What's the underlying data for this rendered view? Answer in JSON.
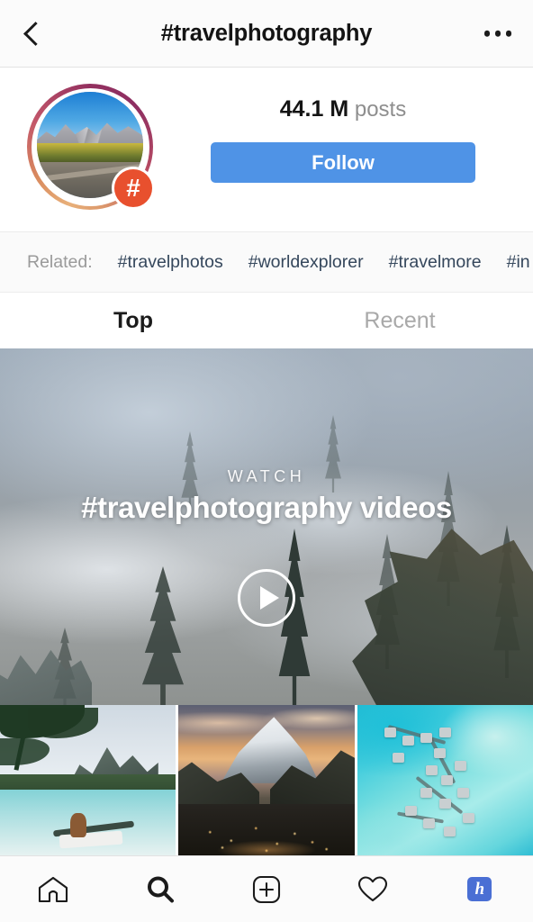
{
  "topbar": {
    "back_icon": "chevron-left-icon",
    "title": "#travelphotography",
    "menu_icon": "more-options-icon"
  },
  "profile": {
    "avatar_icon": "hashtag-avatar",
    "badge_glyph": "#",
    "post_count_value": "44.1 M",
    "post_count_label": "posts",
    "follow_label": "Follow",
    "follow_color": "#4f93e6"
  },
  "related": {
    "label": "Related:",
    "tags": [
      "#travelphotos",
      "#worldexplorer",
      "#travelmore",
      "#in"
    ]
  },
  "tabs": [
    {
      "label": "Top",
      "active": true
    },
    {
      "label": "Recent",
      "active": false
    }
  ],
  "hero": {
    "watch_label": "WATCH",
    "title": "#travelphotography videos",
    "play_icon": "play-circle-icon"
  },
  "grid": {
    "items": [
      {
        "alt": "tropical-lagoon-photo"
      },
      {
        "alt": "matterhorn-dusk-photo"
      },
      {
        "alt": "overwater-bungalows-photo"
      }
    ]
  },
  "bottomnav": {
    "items": [
      {
        "icon": "home-icon",
        "label": "Home"
      },
      {
        "icon": "search-icon",
        "label": "Search"
      },
      {
        "icon": "add-post-icon",
        "label": "New Post"
      },
      {
        "icon": "heart-icon",
        "label": "Activity"
      },
      {
        "icon": "profile-avatar-icon",
        "label": "h"
      }
    ]
  }
}
